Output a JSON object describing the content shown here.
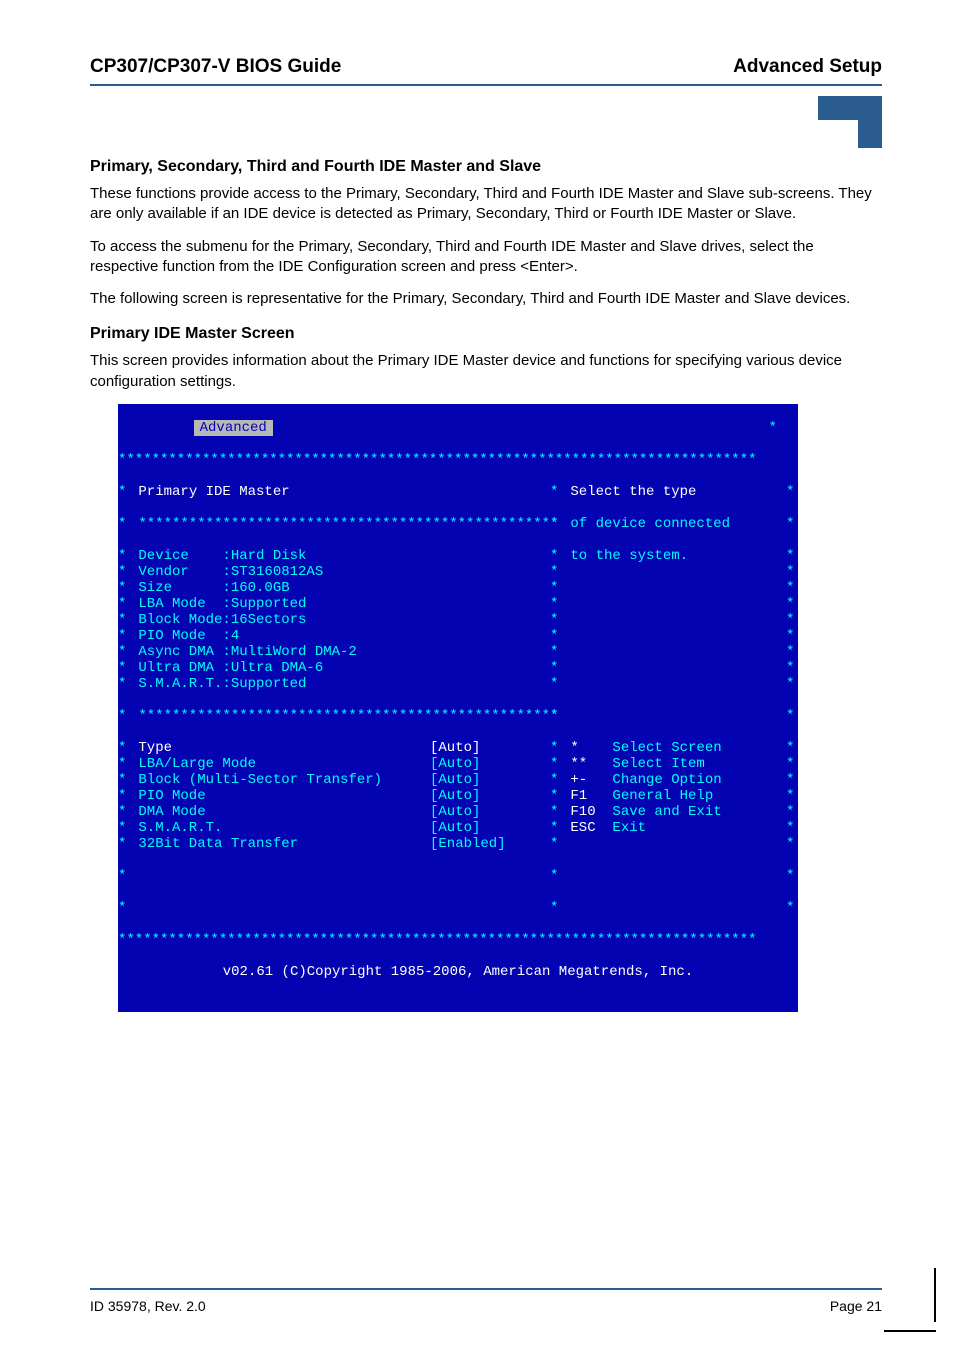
{
  "header": {
    "left": "CP307/CP307-V BIOS Guide",
    "right": "Advanced Setup"
  },
  "section1": {
    "title": "Primary, Secondary, Third and Fourth IDE Master and Slave",
    "p1": "These functions provide access to the Primary, Secondary, Third and Fourth IDE Master and Slave sub-screens. They are only available if an IDE device is detected as Primary, Secondary, Third or Fourth IDE Master or Slave.",
    "p2": "To access the submenu for the Primary, Secondary, Third and Fourth IDE Master and Slave drives, select the respective function from the IDE Configuration screen and press <Enter>.",
    "p3": "The following screen is representative for the Primary, Secondary, Third and Fourth IDE Master and Slave devices."
  },
  "section2": {
    "title": "Primary IDE Master Screen",
    "p1": "This screen provides information about the Primary IDE Master device and functions for specifying various device configuration settings."
  },
  "bios": {
    "menu_tab": "Advanced",
    "title": "Primary IDE Master",
    "info": [
      [
        "Device",
        ":Hard Disk"
      ],
      [
        "Vendor",
        ":ST3160812AS"
      ],
      [
        "Size",
        ":160.0GB"
      ],
      [
        "LBA Mode",
        ":Supported"
      ],
      [
        "Block Mode",
        ":16Sectors"
      ],
      [
        "PIO Mode",
        ":4"
      ],
      [
        "Async DMA",
        ":MultiWord DMA-2"
      ],
      [
        "Ultra DMA",
        ":Ultra DMA-6"
      ],
      [
        "S.M.A.R.T.",
        ":Supported"
      ]
    ],
    "options": [
      {
        "label": "Type",
        "value": "[Auto]",
        "highlight": true
      },
      {
        "label": "LBA/Large Mode",
        "value": "[Auto]"
      },
      {
        "label": "Block (Multi-Sector Transfer)",
        "value": "[Auto]"
      },
      {
        "label": "PIO Mode",
        "value": "[Auto]"
      },
      {
        "label": "DMA Mode",
        "value": "[Auto]"
      },
      {
        "label": "S.M.A.R.T.",
        "value": "[Auto]"
      },
      {
        "label": "32Bit Data Transfer",
        "value": "[Enabled]"
      }
    ],
    "help": {
      "line1": "Select the type",
      "line2": "of device connected",
      "line3": "to the system."
    },
    "nav": [
      {
        "key": "*",
        "txt": "Select Screen"
      },
      {
        "key": "**",
        "txt": "Select Item"
      },
      {
        "key": "+-",
        "txt": "Change Option"
      },
      {
        "key": "F1",
        "txt": "General Help"
      },
      {
        "key": "F10",
        "txt": "Save and Exit"
      },
      {
        "key": "ESC",
        "txt": "Exit"
      }
    ],
    "copyright": "v02.61 (C)Copyright 1985-2006, American Megatrends, Inc."
  },
  "footer": {
    "left": "ID 35978, Rev. 2.0",
    "right": "Page 21"
  }
}
